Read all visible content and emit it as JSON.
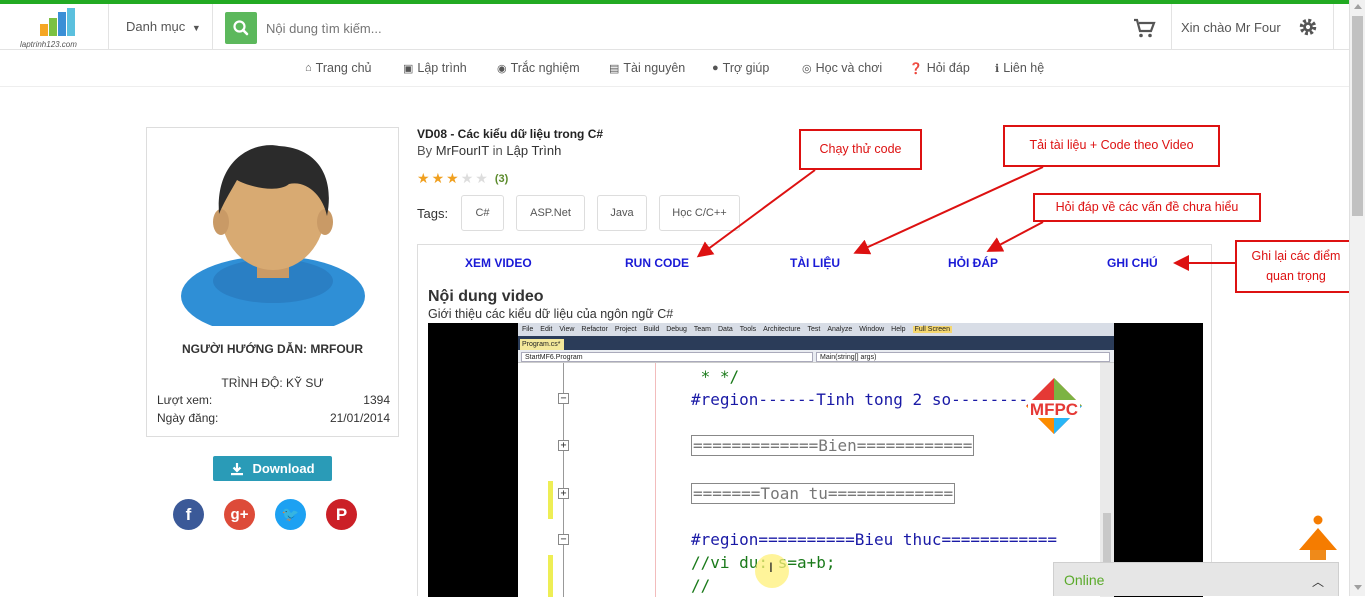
{
  "header": {
    "logo_text": "laptrinh123.com",
    "category_label": "Danh mục",
    "search_placeholder": "Nội dung tìm kiếm...",
    "greeting": "Xin chào Mr Four"
  },
  "nav": [
    {
      "label": "Trang chủ",
      "icon": "home-icon",
      "glyph": "⌂"
    },
    {
      "label": "Lập trình",
      "icon": "code-icon",
      "glyph": "▣"
    },
    {
      "label": "Trắc nghiệm",
      "icon": "quiz-icon",
      "glyph": "◉"
    },
    {
      "label": "Tài nguyên",
      "icon": "book-icon",
      "glyph": "▤"
    },
    {
      "label": "Trợ giúp",
      "icon": "chat-icon",
      "glyph": "●"
    },
    {
      "label": "Học và chơi",
      "icon": "gamepad-icon",
      "glyph": "◎"
    },
    {
      "label": "Hỏi đáp",
      "icon": "question-icon",
      "glyph": "❓"
    },
    {
      "label": "Liên hệ",
      "icon": "info-icon",
      "glyph": "ℹ"
    }
  ],
  "profile": {
    "mentor_label": "NGƯỜI HƯỚNG DẪN: MRFOUR",
    "level_label": "TRÌNH ĐỘ: KỸ SƯ",
    "views_label": "Lượt xem:",
    "views_value": "1394",
    "date_label": "Ngày đăng:",
    "date_value": "21/01/2014",
    "download_label": "Download",
    "social": [
      {
        "name": "facebook-icon",
        "glyph": "f",
        "color": "#3b5998"
      },
      {
        "name": "google-plus-icon",
        "glyph": "g+",
        "color": "#dd4b39"
      },
      {
        "name": "twitter-icon",
        "glyph": "🐦",
        "color": "#1da1f2"
      },
      {
        "name": "pinterest-icon",
        "glyph": "P",
        "color": "#cb2027"
      }
    ]
  },
  "lesson": {
    "title": "VD08 - Các kiểu dữ liệu trong C#",
    "by_prefix": "By",
    "author": "MrFourIT",
    "in_word": "in",
    "category": "Lập Trình",
    "rating": 3,
    "rating_max": 5,
    "rating_count": "(3)",
    "tags_label": "Tags:",
    "tags": [
      "C#",
      "ASP.Net",
      "Java",
      "Học C/C++"
    ]
  },
  "tabs": [
    "XEM VIDEO",
    "RUN CODE",
    "TÀI LIỆU",
    "HỎI ĐÁP",
    "GHI CHÚ"
  ],
  "content": {
    "heading": "Nội dung video",
    "subtitle": "Giới thiệu các kiểu dữ liệu của ngôn ngữ C#"
  },
  "video": {
    "menu": [
      "File",
      "Edit",
      "View",
      "Refactor",
      "Project",
      "Build",
      "Debug",
      "Team",
      "Data",
      "Tools",
      "Architecture",
      "Test",
      "Analyze",
      "Window",
      "Help"
    ],
    "fullscreen": "Full Screen",
    "file_tab": "Program.cs*",
    "combo_left": "StartMF6.Program",
    "combo_right": "Main(string[] args)",
    "code_lines": [
      {
        "text": " * */",
        "kind": "green"
      },
      {
        "text": "#region------Tinh tong 2 so--------",
        "kind": "region"
      },
      {
        "text": "=============Bien============",
        "kind": "boxed"
      },
      {
        "text": "=======Toan tu=============",
        "kind": "boxed"
      },
      {
        "text": "#region==========Bieu thuc============",
        "kind": "region"
      },
      {
        "text": "//vi du: s=a+b;",
        "kind": "green"
      },
      {
        "text": "//",
        "kind": "green"
      }
    ],
    "watermark": "MFPC"
  },
  "callouts": {
    "run_code": "Chạy thử code",
    "documents": "Tải tài liệu + Code theo Video",
    "qa": "Hỏi đáp về các vấn đề chưa hiểu",
    "notes": "Ghi lại các điểm quan trọng"
  },
  "online": {
    "label": "Online"
  },
  "colors": {
    "accent_green": "#22aa22",
    "tab_blue": "#1a1ad6",
    "callout_red": "#dd1111",
    "download_teal": "#2a9bb7"
  }
}
